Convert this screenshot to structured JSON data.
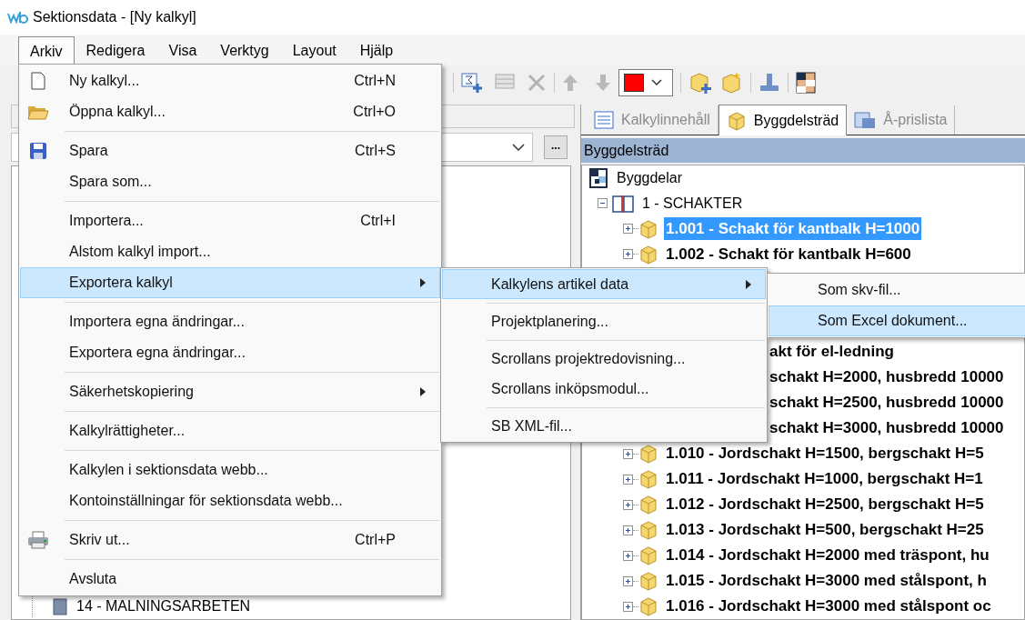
{
  "window": {
    "title": "Sektionsdata - [Ny kalkyl]"
  },
  "menubar": [
    {
      "label": "Arkiv",
      "selected": true
    },
    {
      "label": "Redigera",
      "selected": false
    },
    {
      "label": "Visa",
      "selected": false
    },
    {
      "label": "Verktyg",
      "selected": false
    },
    {
      "label": "Layout",
      "selected": false
    },
    {
      "label": "Hjälp",
      "selected": false
    }
  ],
  "toolbar": {
    "color_picker": {
      "color": "#ff0000"
    }
  },
  "left_panel": {
    "more_button": "...",
    "tree": [
      {
        "label": "14 - MALNINGSARBETEN"
      }
    ]
  },
  "right_panel": {
    "tabs": [
      {
        "label": "Kalkylinnehåll",
        "selected": false
      },
      {
        "label": "Byggdelsträd",
        "selected": true
      },
      {
        "label": "Å-prislista",
        "selected": false
      }
    ],
    "header": "Byggdelsträd",
    "tree": [
      {
        "label": "Byggdelar",
        "children": [
          {
            "label": "1 - SCHAKTER",
            "expanded": true,
            "children": [
              {
                "kind": "node",
                "label": "1.001 - Schakt för kantbalk H=1000",
                "selected": true,
                "expanded": false
              },
              {
                "kind": "node",
                "label": "1.002 - Schakt för kantbalk H=600",
                "selected": false,
                "expanded": false
              },
              {
                "kind": "fragment",
                "label": "akt för el-ledning"
              },
              {
                "kind": "fragment",
                "label": "schakt H=2000, husbredd 10000"
              },
              {
                "kind": "fragment",
                "label": "schakt H=2500, husbredd 10000"
              },
              {
                "kind": "fragment",
                "label": "schakt H=3000, husbredd 10000"
              },
              {
                "kind": "node",
                "label": "1.010 - Jordschakt H=1500, bergschakt H=5",
                "selected": false,
                "expanded": false
              },
              {
                "kind": "node",
                "label": "1.011 - Jordschakt H=1000, bergschakt H=1",
                "selected": false,
                "expanded": false
              },
              {
                "kind": "node",
                "label": "1.012 - Jordschakt H=2500, bergschakt H=5",
                "selected": false,
                "expanded": false
              },
              {
                "kind": "node",
                "label": "1.013 - Jordschakt H=500, bergschakt H=25",
                "selected": false,
                "expanded": false
              },
              {
                "kind": "node",
                "label": "1.014 - Jordschakt H=2000 med träspont, hu",
                "selected": false,
                "expanded": false
              },
              {
                "kind": "node",
                "label": "1.015 - Jordschakt H=3000 med stålspont, h",
                "selected": false,
                "expanded": false
              },
              {
                "kind": "node",
                "label": "1.016 - Jordschakt H=3000 med stålspont oc",
                "selected": false,
                "expanded": false
              }
            ]
          }
        ]
      }
    ]
  },
  "arkiv_menu": [
    {
      "kind": "item",
      "label": "Ny kalkyl...",
      "shortcut": "Ctrl+N",
      "selected": false
    },
    {
      "kind": "item",
      "label": "Öppna kalkyl...",
      "shortcut": "Ctrl+O",
      "selected": false
    },
    {
      "kind": "separator"
    },
    {
      "kind": "item",
      "label": "Spara",
      "shortcut": "Ctrl+S",
      "selected": false
    },
    {
      "kind": "item",
      "label": "Spara som...",
      "selected": false
    },
    {
      "kind": "separator"
    },
    {
      "kind": "item",
      "label": "Importera...",
      "shortcut": "Ctrl+I",
      "selected": false
    },
    {
      "kind": "item",
      "label": "Alstom kalkyl import...",
      "selected": false
    },
    {
      "kind": "submenu",
      "label": "Exportera kalkyl",
      "selected": true
    },
    {
      "kind": "separator"
    },
    {
      "kind": "item",
      "label": "Importera egna ändringar...",
      "selected": false
    },
    {
      "kind": "item",
      "label": "Exportera egna ändringar...",
      "selected": false
    },
    {
      "kind": "separator"
    },
    {
      "kind": "submenu",
      "label": "Säkerhetskopiering",
      "selected": false
    },
    {
      "kind": "separator"
    },
    {
      "kind": "item",
      "label": "Kalkylrättigheter...",
      "selected": false
    },
    {
      "kind": "separator"
    },
    {
      "kind": "item",
      "label": "Kalkylen i sektionsdata webb...",
      "selected": false
    },
    {
      "kind": "item",
      "label": "Kontoinställningar för sektionsdata webb...",
      "selected": false
    },
    {
      "kind": "separator"
    },
    {
      "kind": "item",
      "label": "Skriv ut...",
      "shortcut": "Ctrl+P",
      "selected": false
    },
    {
      "kind": "separator"
    },
    {
      "kind": "item",
      "label": "Avsluta",
      "selected": false
    }
  ],
  "export_submenu": [
    {
      "kind": "submenu",
      "label": "Kalkylens artikel data",
      "selected": true
    },
    {
      "kind": "separator"
    },
    {
      "kind": "item",
      "label": "Projektplanering...",
      "selected": false
    },
    {
      "kind": "separator"
    },
    {
      "kind": "item",
      "label": "Scrollans projektredovisning...",
      "selected": false
    },
    {
      "kind": "item",
      "label": "Scrollans inköpsmodul...",
      "selected": false
    },
    {
      "kind": "separator"
    },
    {
      "kind": "item",
      "label": "SB XML-fil...",
      "selected": false
    }
  ],
  "article_submenu": [
    {
      "kind": "item",
      "label": "Som skv-fil...",
      "selected": false
    },
    {
      "kind": "item",
      "label": "Som Excel dokument...",
      "selected": true
    }
  ]
}
